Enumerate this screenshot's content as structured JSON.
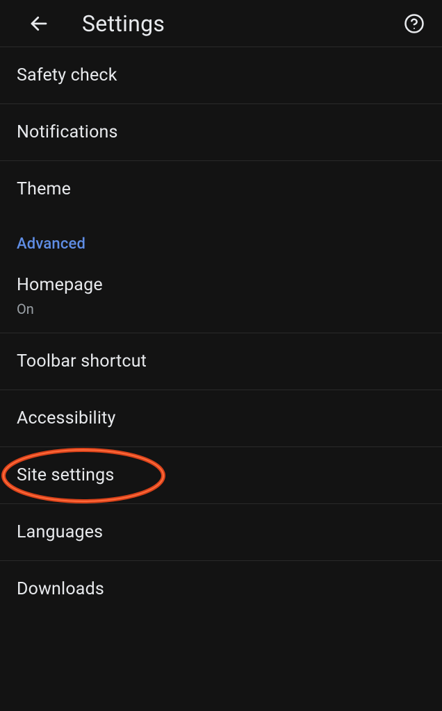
{
  "header": {
    "title": "Settings"
  },
  "items": {
    "safetyCheck": "Safety check",
    "notifications": "Notifications",
    "theme": "Theme",
    "advanced": "Advanced",
    "homepage": "Homepage",
    "homepageStatus": "On",
    "toolbarShortcut": "Toolbar shortcut",
    "accessibility": "Accessibility",
    "siteSettings": "Site settings",
    "languages": "Languages",
    "downloads": "Downloads"
  },
  "annotation": {
    "highlightColor": "#d9421a"
  }
}
